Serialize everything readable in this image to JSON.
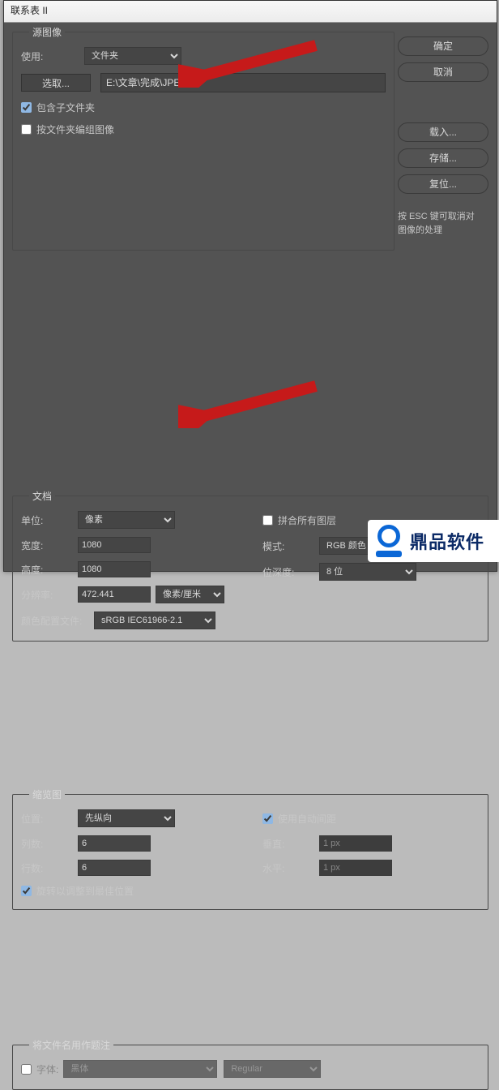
{
  "window": {
    "title": "联系表 II"
  },
  "buttons": {
    "ok": "确定",
    "cancel": "取消",
    "load": "载入...",
    "save": "存储...",
    "reset": "复位..."
  },
  "esc_hint_line1": "按 ESC 键可取消对",
  "esc_hint_line2": "图像的处理",
  "source": {
    "legend": "源图像",
    "use_label": "使用:",
    "use_value": "文件夹",
    "choose_button": "选取...",
    "path": "E:\\文章\\完成\\JPEG",
    "include_sub_label": "包含子文件夹",
    "include_sub_checked": true,
    "group_by_folder_label": "按文件夹编组图像",
    "group_by_folder_checked": false
  },
  "doc": {
    "legend": "文档",
    "unit_label": "单位:",
    "unit_value": "像素",
    "flatten_label": "拼合所有图层",
    "flatten_checked": false,
    "width_label": "宽度:",
    "width_value": "1080",
    "height_label": "高度:",
    "height_value": "1080",
    "res_label": "分辨率:",
    "res_value": "472.441",
    "res_unit": "像素/厘米",
    "mode_label": "模式:",
    "mode_value": "RGB 颜色",
    "depth_label": "位深度:",
    "depth_value": "8 位",
    "profile_label": "颜色配置文件:",
    "profile_value": "sRGB IEC61966-2.1"
  },
  "thumb": {
    "legend": "缩览图",
    "pos_label": "位置:",
    "pos_value": "先纵向",
    "cols_label": "列数:",
    "cols_value": "6",
    "rows_label": "行数:",
    "rows_value": "6",
    "auto_label": "使用自动间距",
    "auto_checked": true,
    "v_label": "垂直:",
    "v_value": "1 px",
    "h_label": "水平:",
    "h_value": "1 px",
    "rotate_label": "旋转以调整到最佳位置",
    "rotate_checked": true
  },
  "fname": {
    "legend": "将文件名用作题注",
    "font_label": "字体:",
    "font_checked": false,
    "font_value": "黑体",
    "style_value": "Regular"
  },
  "watermark": "鼎品软件"
}
